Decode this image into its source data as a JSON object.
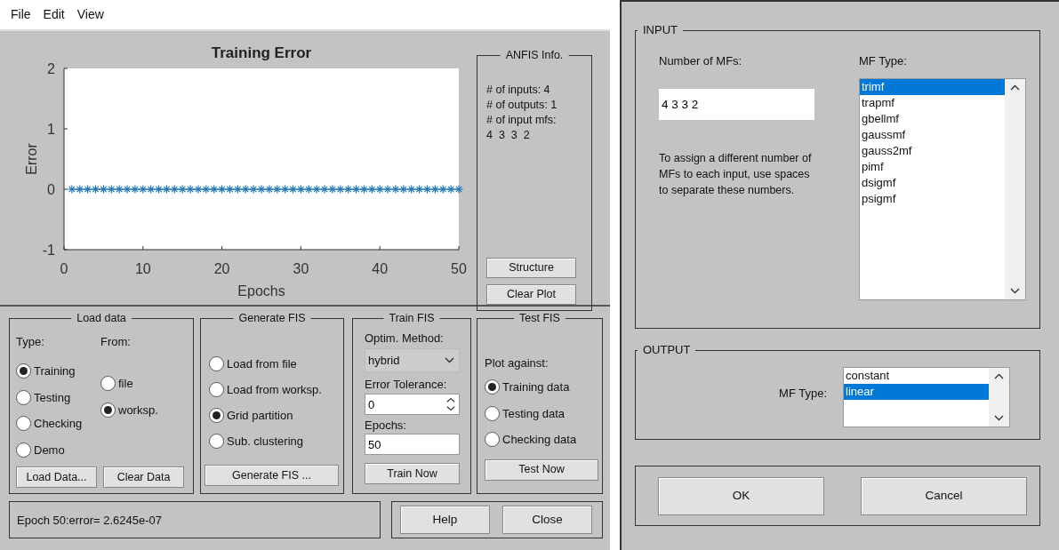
{
  "menu": [
    {
      "label": "File"
    },
    {
      "label": "Edit"
    },
    {
      "label": "View"
    }
  ],
  "plot": {
    "chart_data": {
      "type": "line",
      "title": "Training Error",
      "xlabel": "Epochs",
      "ylabel": "Error",
      "x": [
        1,
        2,
        3,
        4,
        5,
        6,
        7,
        8,
        9,
        10,
        11,
        12,
        13,
        14,
        15,
        16,
        17,
        18,
        19,
        20,
        21,
        22,
        23,
        24,
        25,
        26,
        27,
        28,
        29,
        30,
        31,
        32,
        33,
        34,
        35,
        36,
        37,
        38,
        39,
        40,
        41,
        42,
        43,
        44,
        45,
        46,
        47,
        48,
        49,
        50
      ],
      "series": [
        {
          "color": "#1f77b4",
          "marker": "cross",
          "values": [
            0,
            0,
            0,
            0,
            0,
            0,
            0,
            0,
            0,
            0,
            0,
            0,
            0,
            0,
            0,
            0,
            0,
            0,
            0,
            0,
            0,
            0,
            0,
            0,
            0,
            0,
            0,
            0,
            0,
            0,
            0,
            0,
            0,
            0,
            0,
            0,
            0,
            0,
            0,
            0,
            0,
            0,
            0,
            0,
            0,
            0,
            0,
            0,
            0,
            0
          ]
        }
      ],
      "xlim": [
        0,
        50
      ],
      "ylim": [
        -1,
        2
      ],
      "xticks": [
        0,
        10,
        20,
        30,
        40,
        50
      ],
      "yticks": [
        -1,
        0,
        1,
        2
      ]
    }
  },
  "anfis_info": {
    "title": "ANFIS Info.",
    "lines": [
      "# of inputs: 4",
      "# of outputs: 1",
      "# of input mfs:",
      "4  3  3  2"
    ],
    "buttons": [
      "Structure",
      "Clear Plot"
    ]
  },
  "load_data": {
    "title": "Load data",
    "type_label": "Type:",
    "from_label": "From:",
    "types": [
      {
        "label": "Training",
        "selected": true
      },
      {
        "label": "Testing",
        "selected": false
      },
      {
        "label": "Checking",
        "selected": false
      },
      {
        "label": "Demo",
        "selected": false
      }
    ],
    "sources": [
      {
        "label": "file",
        "selected": false
      },
      {
        "label": "worksp.",
        "selected": true
      }
    ],
    "buttons": [
      "Load Data...",
      "Clear Data"
    ]
  },
  "generate_fis": {
    "title": "Generate FIS",
    "options": [
      {
        "label": "Load from file",
        "selected": false
      },
      {
        "label": "Load from worksp.",
        "selected": false
      },
      {
        "label": "Grid partition",
        "selected": true
      },
      {
        "label": "Sub. clustering",
        "selected": false
      }
    ],
    "button": "Generate FIS ..."
  },
  "train_fis": {
    "title": "Train FIS",
    "method_label": "Optim. Method:",
    "method": "hybrid",
    "tolerance_label": "Error Tolerance:",
    "tolerance": "0",
    "epochs_label": "Epochs:",
    "epochs": "50",
    "button": "Train Now"
  },
  "test_fis": {
    "title": "Test FIS",
    "plot_label": "Plot against:",
    "options": [
      {
        "label": "Training data",
        "selected": true
      },
      {
        "label": "Testing data",
        "selected": false
      },
      {
        "label": "Checking data",
        "selected": false
      }
    ],
    "button": "Test Now"
  },
  "status": "Epoch 50:error= 2.6245e-07",
  "buttons": [
    "Help",
    "Close"
  ],
  "dialog": {
    "input": {
      "title": "INPUT",
      "count_label": "Number of MFs:",
      "count": "4 3 3 2",
      "hint": "To assign a different number of MFs to each input, use spaces to separate these numbers.",
      "type_label": "MF Type:",
      "types": [
        {
          "label": "trimf",
          "selected": true
        },
        {
          "label": "trapmf",
          "selected": false
        },
        {
          "label": "gbellmf",
          "selected": false
        },
        {
          "label": "gaussmf",
          "selected": false
        },
        {
          "label": "gauss2mf",
          "selected": false
        },
        {
          "label": "pimf",
          "selected": false
        },
        {
          "label": "dsigmf",
          "selected": false
        },
        {
          "label": "psigmf",
          "selected": false
        }
      ]
    },
    "output": {
      "title": "OUTPUT",
      "type_label": "MF Type:",
      "types": [
        {
          "label": "constant",
          "selected": false
        },
        {
          "label": "linear",
          "selected": true
        }
      ]
    },
    "buttons": [
      "OK",
      "Cancel"
    ]
  }
}
